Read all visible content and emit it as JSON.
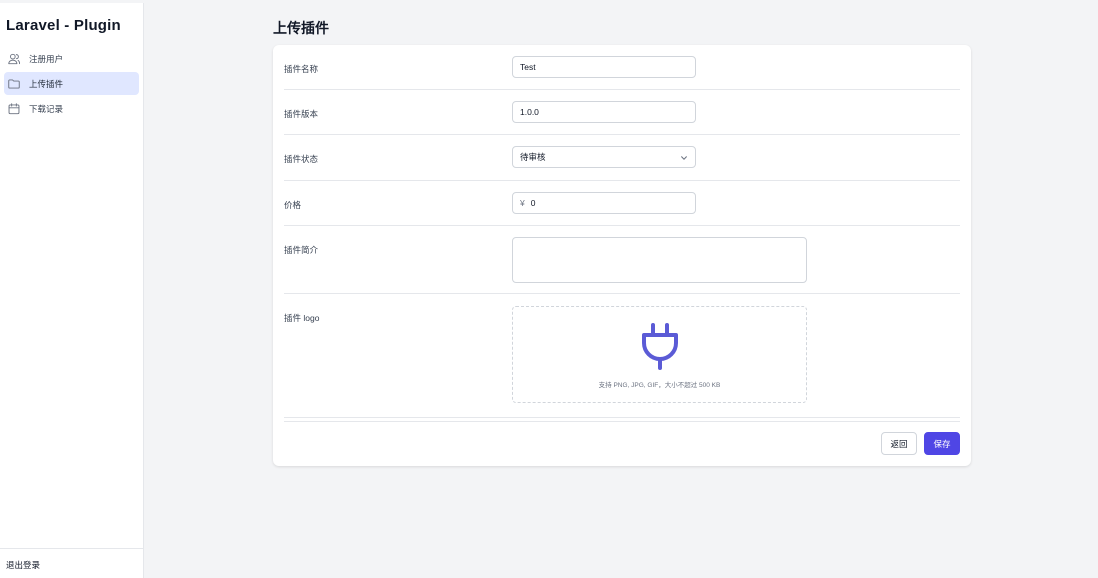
{
  "app": {
    "title": "Laravel - Plugin"
  },
  "sidebar": {
    "items": [
      {
        "label": "注册用户",
        "icon": "users-icon"
      },
      {
        "label": "上传插件",
        "icon": "folder-icon",
        "active": true
      },
      {
        "label": "下载记录",
        "icon": "calendar-icon"
      }
    ],
    "logout_label": "退出登录"
  },
  "page": {
    "title": "上传插件"
  },
  "form": {
    "name": {
      "label": "插件名称",
      "value": "Test"
    },
    "version": {
      "label": "插件版本",
      "value": "1.0.0"
    },
    "status": {
      "label": "插件状态",
      "value": "待审核"
    },
    "price": {
      "label": "价格",
      "currency": "¥",
      "value": "0"
    },
    "intro": {
      "label": "插件简介",
      "value": ""
    },
    "logo": {
      "label": "插件 logo",
      "hint": "支持 PNG, JPG, GIF，大小不超过 500 KB",
      "icon": "plug-icon"
    }
  },
  "actions": {
    "back_label": "返回",
    "save_label": "保存"
  },
  "colors": {
    "accent": "#4f46e5",
    "active_bg": "#e0e7ff",
    "plug": "#5b5bd6"
  }
}
